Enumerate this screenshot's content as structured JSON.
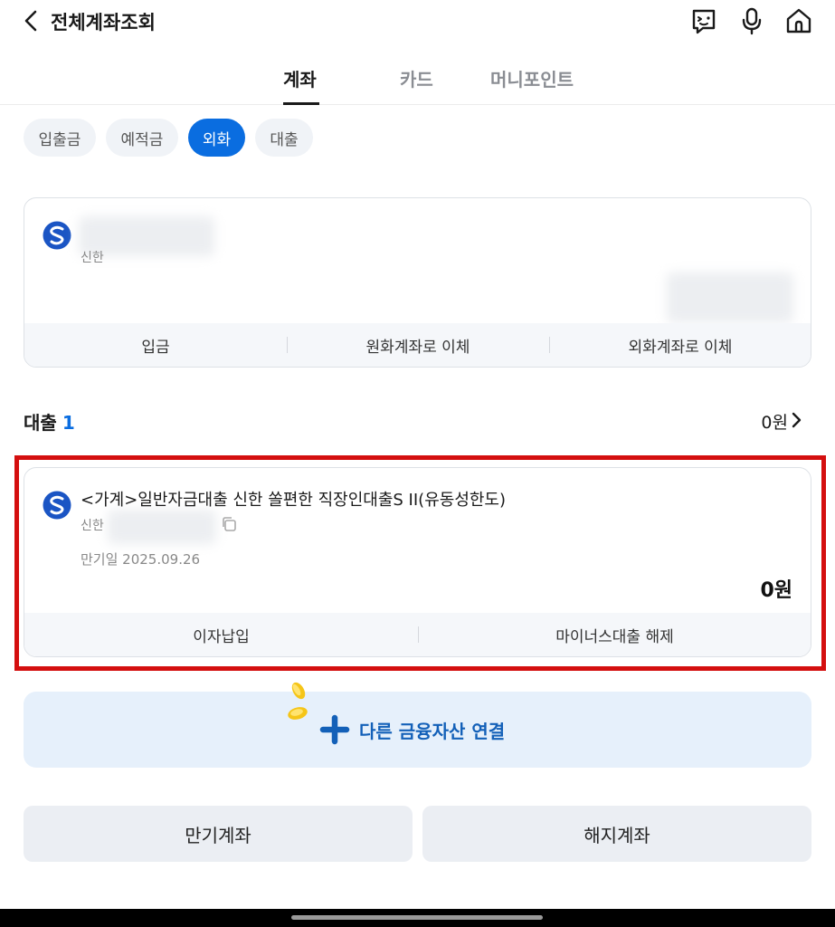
{
  "header": {
    "title": "전체계좌조회",
    "icons": [
      "back-icon",
      "chatbot-icon",
      "mic-icon",
      "home-icon"
    ]
  },
  "tabs": [
    {
      "label": "계좌",
      "active": true
    },
    {
      "label": "카드",
      "active": false
    },
    {
      "label": "머니포인트",
      "active": false
    }
  ],
  "filters": [
    {
      "label": "입출금",
      "active": false
    },
    {
      "label": "예적금",
      "active": false
    },
    {
      "label": "외화",
      "active": true
    },
    {
      "label": "대출",
      "active": false
    }
  ],
  "fx_account": {
    "bank_prefix": "신한",
    "actions": [
      "입금",
      "원화계좌로 이체",
      "외화계좌로 이체"
    ]
  },
  "loan_section": {
    "title": "대출",
    "count": "1",
    "total": "0원"
  },
  "loan": {
    "name": "<가계>일반자금대출 신한 쏠편한 직장인대출S II(유동성한도)",
    "bank_prefix": "신한",
    "due_label": "만기일 2025.09.26",
    "amount": "0원",
    "actions": [
      "이자납입",
      "마이너스대출 해제"
    ]
  },
  "connect": {
    "label": "다른 금융자산 연결"
  },
  "bottom_buttons": [
    "만기계좌",
    "해지계좌"
  ],
  "colors": {
    "accent": "#0a6de0",
    "highlight_border": "#d40f0f",
    "connect_bg": "#e6f0fb",
    "connect_text": "#1360b8"
  }
}
